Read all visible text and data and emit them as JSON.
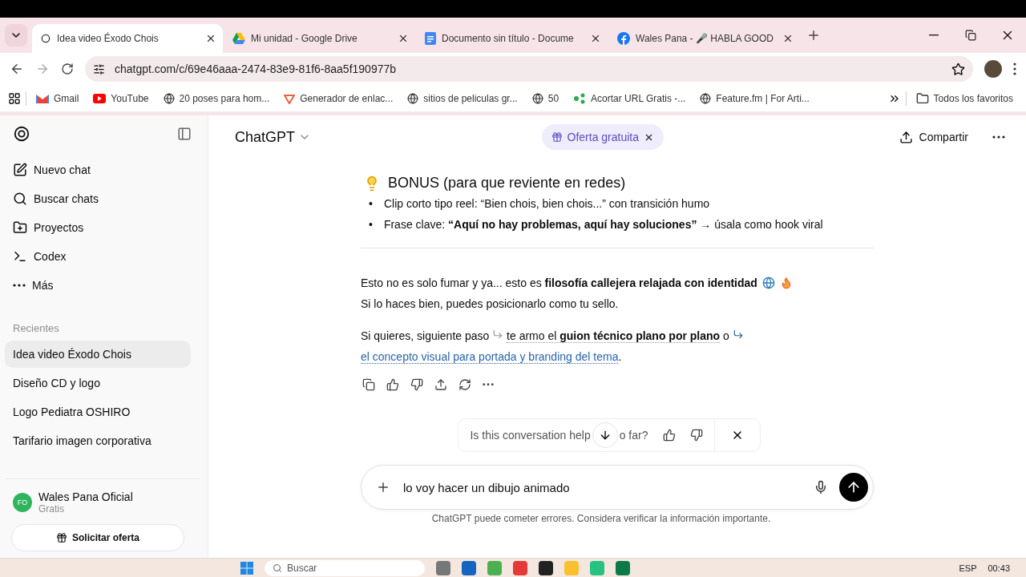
{
  "browser": {
    "tabs": [
      {
        "title": "Idea video Éxodo Chois",
        "selected": true
      },
      {
        "title": "Mi unidad - Google Drive",
        "selected": false
      },
      {
        "title": "Documento sin título - Docume",
        "selected": false
      },
      {
        "title": "Wales Pana - 🎤 HABLA GOOD",
        "selected": false
      }
    ],
    "address": "chatgpt.com/c/69e46aaa-2474-83e9-81f6-8aa5f190977b",
    "bookmarks": [
      "Gmail",
      "YouTube",
      "20 poses para hom...",
      "Generador de enlac...",
      "sitios de peliculas gr...",
      "50",
      "Acortar URL Gratis -...",
      "Feature.fm | For Arti..."
    ],
    "all_bookmarks": "Todos los favoritos"
  },
  "sidebar": {
    "nav": [
      {
        "label": "Nuevo chat",
        "kind": "new"
      },
      {
        "label": "Buscar chats",
        "kind": "search"
      },
      {
        "label": "Proyectos",
        "kind": "projects"
      },
      {
        "label": "Codex",
        "kind": "codex"
      },
      {
        "label": "Más",
        "kind": "more"
      }
    ],
    "section": "Recientes",
    "chats": [
      {
        "title": "Idea video Éxodo Chois",
        "selected": true
      },
      {
        "title": "Diseño CD y logo",
        "selected": false
      },
      {
        "title": "Logo Pediatra OSHIRO",
        "selected": false
      },
      {
        "title": "Tarifario imagen corporativa",
        "selected": false
      }
    ],
    "user": {
      "initials": "FO",
      "name": "Wales Pana Oficial",
      "plan": "Gratis"
    },
    "offer_button": "Solicitar oferta"
  },
  "header": {
    "title": "ChatGPT",
    "promo": "Oferta gratuita",
    "share": "Compartir"
  },
  "message": {
    "heading": "BONUS (para que reviente en redes)",
    "bullets": [
      {
        "marker": "•",
        "text": "Clip corto tipo reel: “Bien chois, bien chois...” con transición humo"
      },
      {
        "marker": "•",
        "text": "Frase clave: **“Aquí no hay problemas, aquí hay soluciones”** → úsala como hook viral"
      }
    ],
    "paragraph_1": "Esto no es solo fumar y ya... esto es **filosofía callejera relajada con identidad**",
    "paragraph_2": "Si lo haces bien, puedes posicionarlo como tu sello.",
    "next_step": [
      {
        "kind": "text",
        "text": "Si quieres, siguiente paso"
      },
      {
        "kind": "suggestion",
        "text": "te armo el **guion técnico plano por plano**"
      },
      {
        "kind": "text",
        "text": "o"
      },
      {
        "kind": "link",
        "text": "el concepto visual para portada y branding del tema"
      },
      {
        "kind": "text",
        "text": "."
      }
    ]
  },
  "feedback": {
    "question_start": "Is this conversation help",
    "question_end": "o far?"
  },
  "composer": {
    "value": "lo voy hacer un dibujo animado"
  },
  "disclaimer": "ChatGPT puede cometer errores. Considera verificar la información importante.",
  "taskbar": {
    "search": "Buscar",
    "language": "ESP",
    "time": "00:43"
  }
}
